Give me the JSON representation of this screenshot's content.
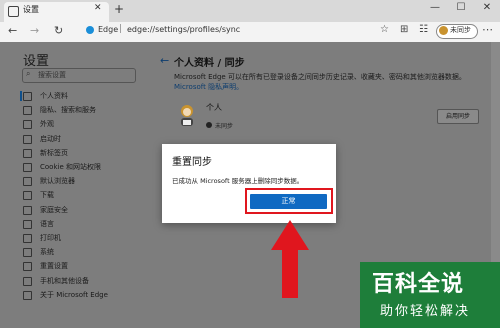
{
  "browser": {
    "tab_label": "设置",
    "tab_close": "✕",
    "new_tab": "+",
    "minimize": "—",
    "maximize": "☐",
    "close": "✕",
    "back": "←",
    "forward": "→",
    "refresh": "↻",
    "site_label": "Edge",
    "url": "edge://settings/profiles/sync",
    "favorites_icon": "☆",
    "collections_icon": "⊞",
    "profile_label": "未同步",
    "more": "⋯"
  },
  "sidebar": {
    "title": "设置",
    "search_placeholder": "搜索设置",
    "items": [
      {
        "label": "个人资料",
        "icon": "person-icon"
      },
      {
        "label": "隐私、搜索和服务",
        "icon": "lock-icon"
      },
      {
        "label": "外观",
        "icon": "appearance-icon"
      },
      {
        "label": "启动时",
        "icon": "power-icon"
      },
      {
        "label": "新标签页",
        "icon": "new-tab-icon"
      },
      {
        "label": "Cookie 和网站权限",
        "icon": "site-permissions-icon"
      },
      {
        "label": "默认浏览器",
        "icon": "browser-icon"
      },
      {
        "label": "下载",
        "icon": "download-icon"
      },
      {
        "label": "家庭安全",
        "icon": "family-icon"
      },
      {
        "label": "语言",
        "icon": "language-icon"
      },
      {
        "label": "打印机",
        "icon": "printer-icon"
      },
      {
        "label": "系统",
        "icon": "system-icon"
      },
      {
        "label": "重置设置",
        "icon": "reset-icon"
      },
      {
        "label": "手机和其他设备",
        "icon": "phone-icon"
      },
      {
        "label": "关于 Microsoft Edge",
        "icon": "edge-icon"
      }
    ]
  },
  "content": {
    "breadcrumb": "个人资料 / 同步",
    "description": "Microsoft Edge 可以在所有已登录设备之间同步历史记录、收藏夹、密码和其他浏览器数据。",
    "privacy_link": "Microsoft 隐私声明。",
    "profile_name": "个人",
    "sync_status": "未同步",
    "enable_sync_button": "启用同步"
  },
  "dialog": {
    "title": "重置同步",
    "message": "已成功从 Microsoft 服务器上删除同步数据。",
    "ok_button": "正常"
  },
  "watermark": {
    "title": "百科全说",
    "subtitle": "助你轻松解决"
  },
  "colors": {
    "accent": "#0f69c2",
    "highlight": "#e0161e",
    "watermark": "#1e7e3a"
  }
}
